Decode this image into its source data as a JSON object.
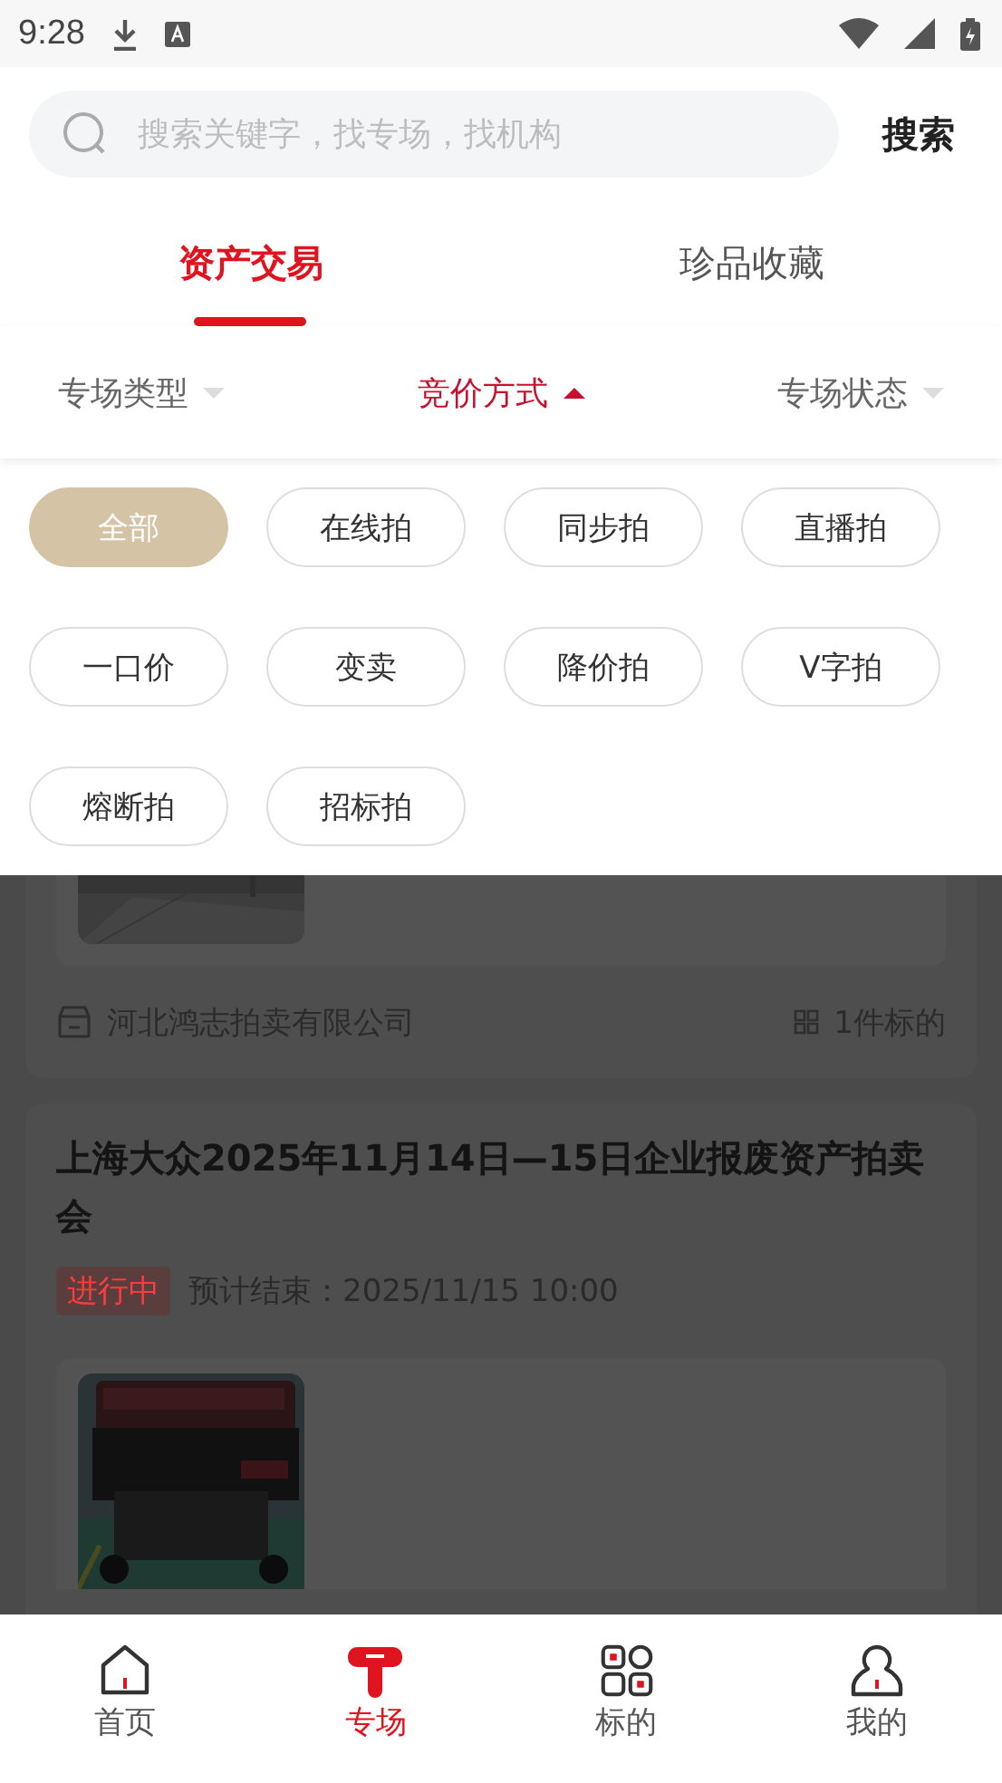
{
  "status_bar": {
    "time": "9:28"
  },
  "search": {
    "placeholder": "搜索关键字，找专场，找机构",
    "button": "搜索"
  },
  "tabs": [
    {
      "label": "资产交易",
      "selected": true
    },
    {
      "label": "珍品收藏",
      "selected": false
    }
  ],
  "filters": [
    {
      "label": "专场类型",
      "selected": false
    },
    {
      "label": "竞价方式",
      "selected": true
    },
    {
      "label": "专场状态",
      "selected": false
    }
  ],
  "options": [
    {
      "label": "全部",
      "selected": true
    },
    {
      "label": "在线拍",
      "selected": false
    },
    {
      "label": "同步拍",
      "selected": false
    },
    {
      "label": "直播拍",
      "selected": false
    },
    {
      "label": "一口价",
      "selected": false
    },
    {
      "label": "变卖",
      "selected": false
    },
    {
      "label": "降价拍",
      "selected": false
    },
    {
      "label": "V字拍",
      "selected": false
    },
    {
      "label": "熔断拍",
      "selected": false
    },
    {
      "label": "招标拍",
      "selected": false
    }
  ],
  "list": [
    {
      "org": "河北鸿志拍卖有限公司",
      "count": "1件标的"
    },
    {
      "title": "上海大众2025年11月14日—15日企业报废资产拍卖会",
      "status": "进行中",
      "end": "预计结束：2025/11/15 10:00"
    }
  ],
  "bottom_nav": [
    {
      "label": "首页",
      "selected": false
    },
    {
      "label": "专场",
      "selected": true
    },
    {
      "label": "标的",
      "selected": false
    },
    {
      "label": "我的",
      "selected": false
    }
  ]
}
